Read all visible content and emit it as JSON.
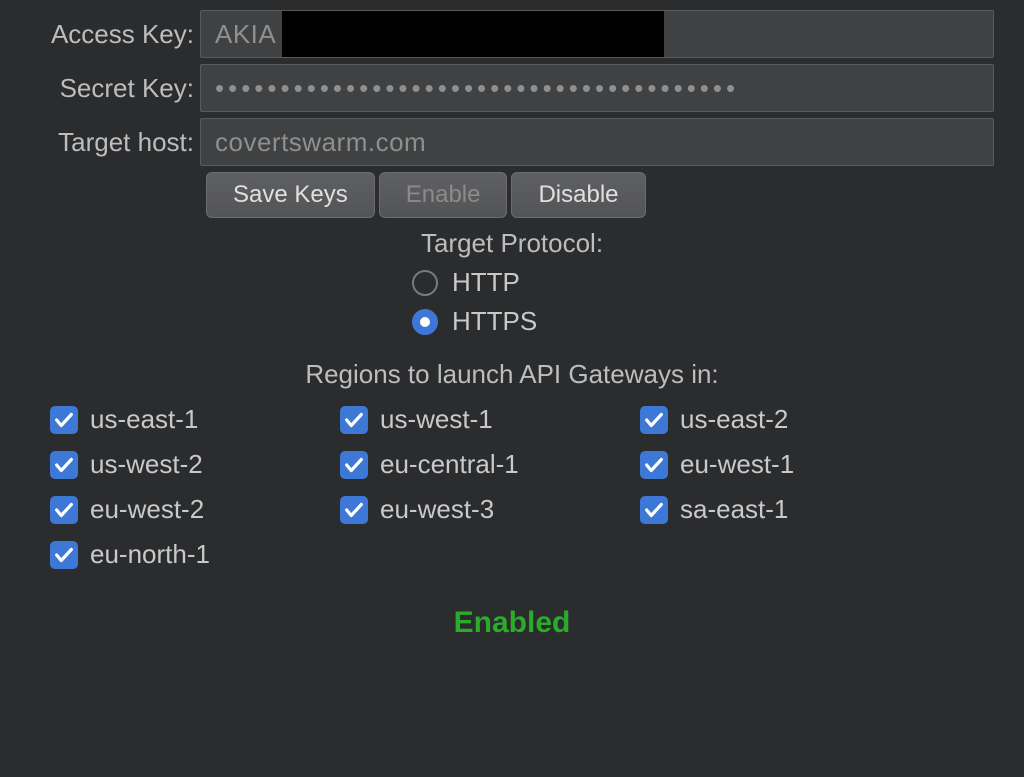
{
  "form": {
    "access_key": {
      "label": "Access Key:",
      "value": "AKIA"
    },
    "secret_key": {
      "label": "Secret Key:",
      "value": "••••••••••••••••••••••••••••••••••••••••"
    },
    "target_host": {
      "label": "Target host:",
      "value": "covertswarm.com"
    }
  },
  "buttons": {
    "save_keys": "Save Keys",
    "enable": "Enable",
    "disable": "Disable"
  },
  "protocol": {
    "title": "Target Protocol:",
    "options": {
      "http": "HTTP",
      "https": "HTTPS"
    },
    "selected": "https"
  },
  "regions": {
    "title": "Regions to launch API Gateways in:",
    "items": [
      "us-east-1",
      "us-west-1",
      "us-east-2",
      "us-west-2",
      "eu-central-1",
      "eu-west-1",
      "eu-west-2",
      "eu-west-3",
      "sa-east-1",
      "eu-north-1"
    ]
  },
  "status": "Enabled",
  "colors": {
    "accent": "#3e78d6",
    "status_ok": "#2aab2a"
  }
}
